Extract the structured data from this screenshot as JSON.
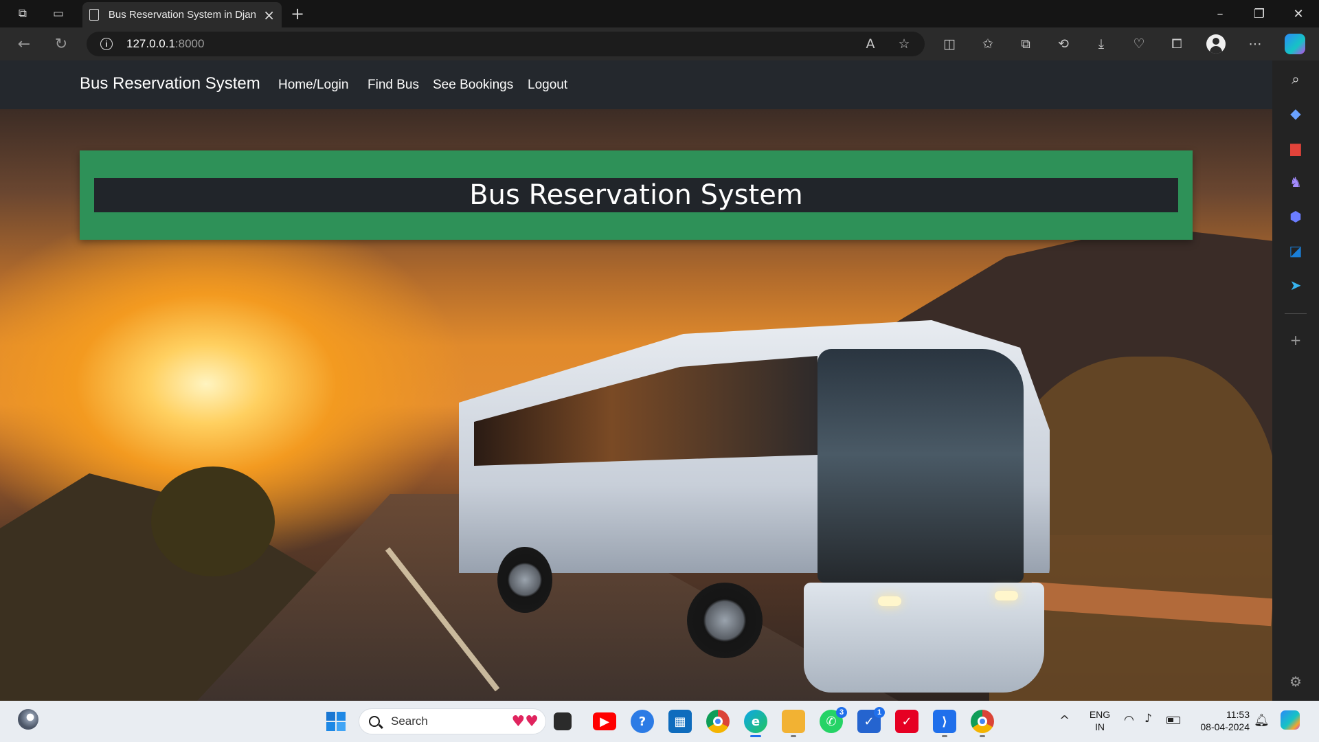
{
  "browser": {
    "tab_title": "Bus Reservation System in Djang",
    "url_host": "127.0.0.1",
    "url_port": ":8000"
  },
  "site": {
    "brand": "Bus Reservation System",
    "nav": [
      {
        "label": "Home/Login"
      },
      {
        "label": "Find Bus"
      },
      {
        "label": "See Bookings"
      },
      {
        "label": "Logout"
      }
    ],
    "hero_title": "Bus Reservation System",
    "colors": {
      "navbar": "#24282d",
      "hero_green": "#2e9158",
      "hero_dark": "#21252a"
    }
  },
  "taskbar": {
    "search_label": "Search",
    "whatsapp_badge": "3",
    "todo_badge": "1",
    "lang_line1": "ENG",
    "lang_line2": "IN",
    "time": "11:53",
    "date": "08-04-2024"
  }
}
